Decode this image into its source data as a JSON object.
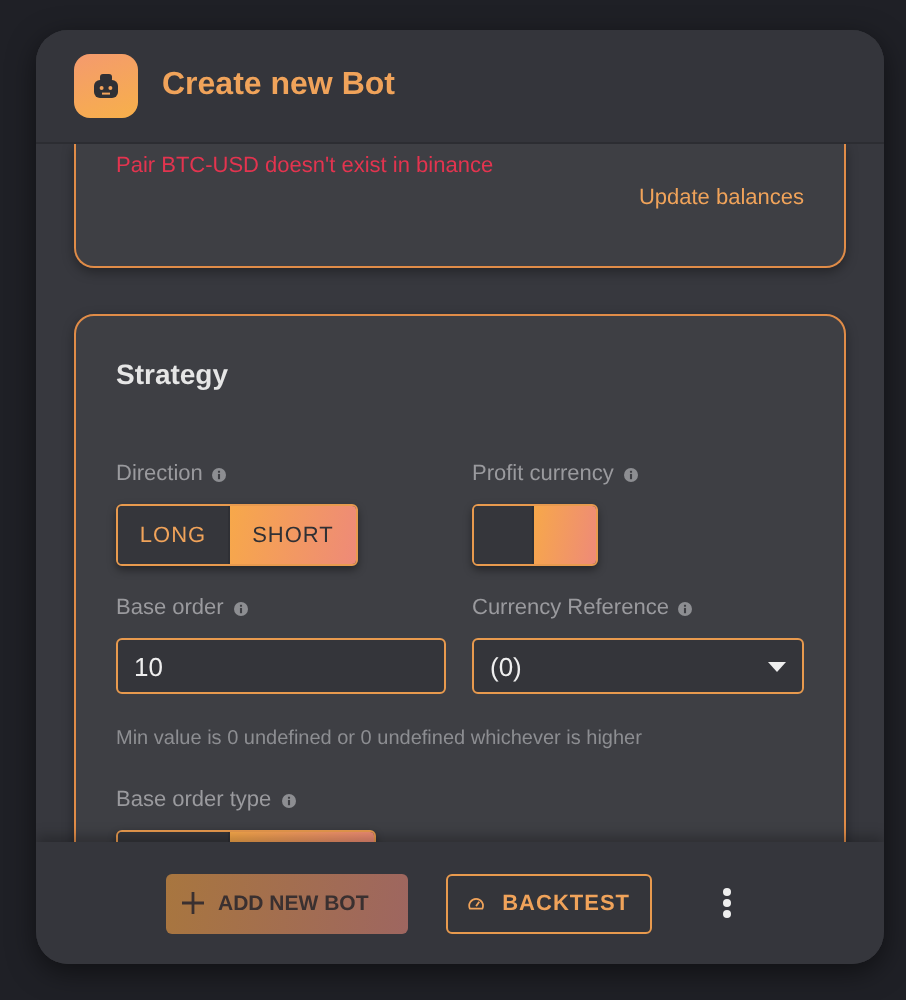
{
  "dialog": {
    "title": "Create new Bot"
  },
  "exchange_card": {
    "error": "Pair BTC-USD doesn't exist in binance",
    "link": "Update balances"
  },
  "strategy": {
    "title": "Strategy",
    "direction": {
      "label": "Direction",
      "options": [
        {
          "label": "LONG",
          "selected": false
        },
        {
          "label": "SHORT",
          "selected": true
        }
      ]
    },
    "profit_currency": {
      "label": "Profit currency",
      "options": [
        {
          "selected": false
        },
        {
          "selected": true
        }
      ]
    },
    "base_order": {
      "label": "Base order",
      "value": "10"
    },
    "currency_reference": {
      "label": "Currency Reference",
      "value": "(0)"
    },
    "helper": "Min value is 0 undefined or 0 undefined whichever is higher",
    "base_order_type": {
      "label": "Base order type",
      "options": [
        {
          "selected": false
        },
        {
          "selected": true
        }
      ]
    }
  },
  "footer": {
    "buttons": [
      {
        "kind": "add",
        "label": "ADD NEW BOT",
        "disabled": true
      },
      {
        "kind": "backtest",
        "label": "BACKTEST",
        "disabled": false
      }
    ]
  }
}
